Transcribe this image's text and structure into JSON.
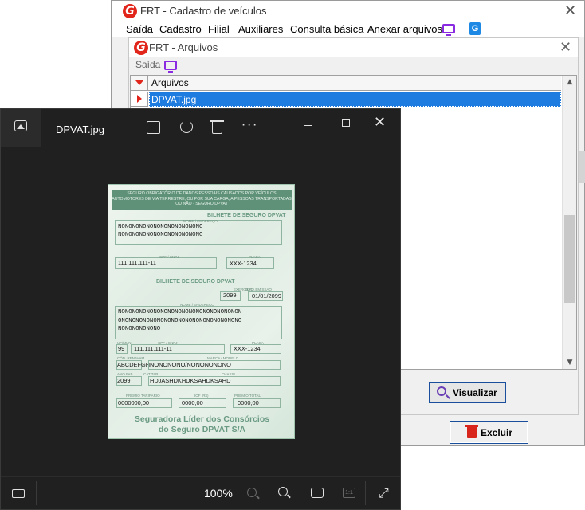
{
  "main_window": {
    "title": "FRT - Cadastro de veículos",
    "close": "✕",
    "menu": [
      "Saída",
      "Cadastro",
      "Filial",
      "Auxiliares",
      "Consulta básica",
      "Anexar arquivos"
    ]
  },
  "arquivos_window": {
    "title": "FRT - Arquivos",
    "close": "✕",
    "toolbar_saida": "Saída",
    "grid": {
      "header": "Arquivos",
      "rows": [
        "DPVAT.jpg"
      ]
    },
    "visualizar_label": "Visualizar"
  },
  "excluir_label": "Excluir",
  "viewer": {
    "filename": "DPVAT.jpg",
    "more": "···",
    "close": "✕",
    "zoom": "100%",
    "actual_size": "1:1",
    "fullscreen": "⤢"
  },
  "document": {
    "header": "SEGURO OBRIGATÓRIO DE DANOS PESSOAIS CAUSADOS POR VEÍCULOS AUTOMOTORES DE VIA TERRESTRE, OU POR SUA CARGA, A PESSOAS TRANSPORTADAS OU NÃO - SEGURO DPVAT",
    "bilhete1": "BILHETE DE SEGURO DPVAT",
    "label_nome": "NOME / ENDEREÇO",
    "nome1": "NONONONONONONONONONONONO",
    "nome2": "NONONONONONONONONONONONO",
    "label_cpf": "CPF / CNPJ",
    "cpf": "111.111.111-11",
    "label_placa": "PLACA",
    "placa": "XXX-1234",
    "bilhete2": "BILHETE DE SEGURO DPVAT",
    "label_exercicio": "EXERCÍCIO",
    "exercicio": "2099",
    "label_data": "DATA EMISSÃO",
    "data": "01/01/2099",
    "nome_long1": "NONONONONONONONONONONONONONONONONON",
    "nome_long2": "ONONONONONONONONONONONONONONONONONO",
    "nome_long3": "NONONONONONO",
    "label_uf": "UF/MUN",
    "uf": "99",
    "cpf2": "111.111.111-11",
    "placa2": "XXX-1234",
    "label_renavam": "CÓD. RENAVAM",
    "renavam": "ABCDEFGH",
    "label_marca": "MARCA / MODELO",
    "marca": "NONONONO/NONONONONO",
    "label_ano": "ANO FAB",
    "ano": "2099",
    "label_cat": "CAT TAR",
    "label_chassi": "CHASSI",
    "chassi": "HDJASHDKHDKSAHDKSAHD",
    "label_premio": "PRÊMIO TARIFÁRIO",
    "premio": "0000000,00",
    "label_iof": "IOF (R$)",
    "iof": "0000,00",
    "label_total": "PRÊMIO TOTAL",
    "total": "0000,00",
    "footer1": "Seguradora Líder dos Consórcios",
    "footer2": "do Seguro DPVAT S/A"
  },
  "colors": {
    "accent_red": "#e1251b",
    "selection_blue": "#1e7be0",
    "viewer_bg": "#202020"
  }
}
